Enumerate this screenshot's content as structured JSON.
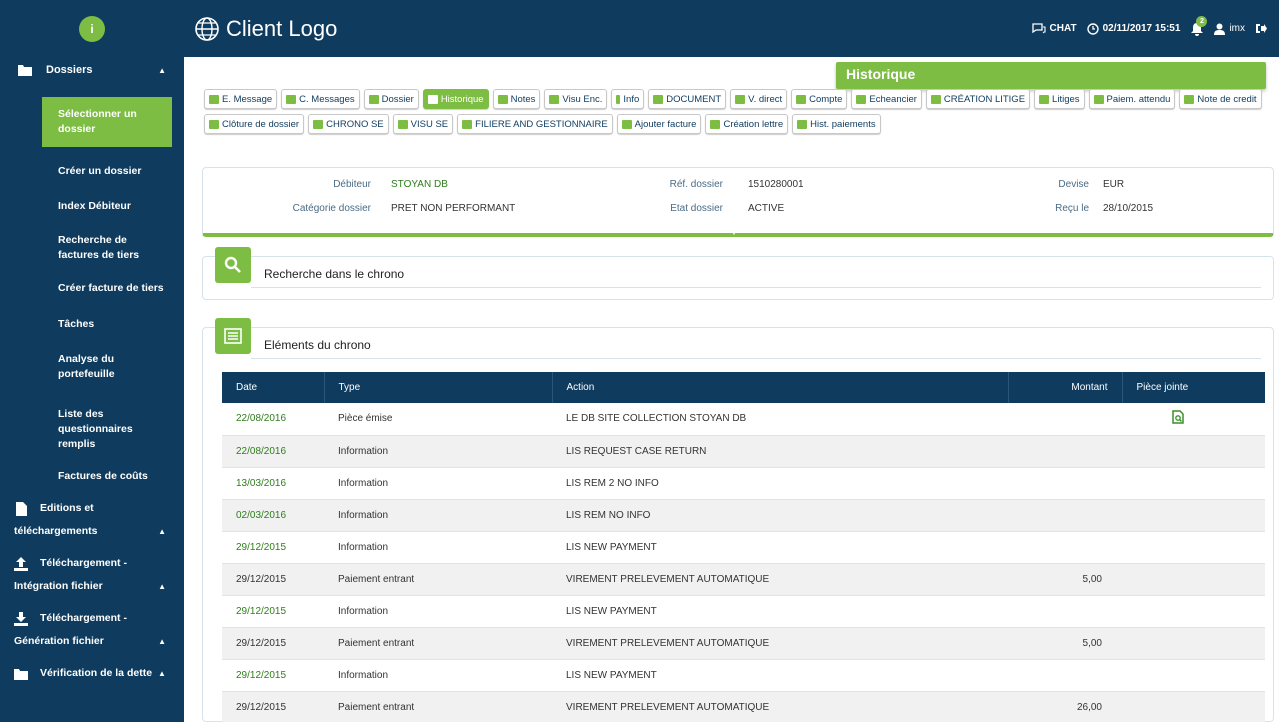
{
  "header": {
    "brand": "Client Logo",
    "chat": "CHAT",
    "datetime": "02/11/2017 15:51",
    "notifications": "2",
    "user": "imx"
  },
  "sidebar": {
    "logo_letter": "i",
    "groups": {
      "dossiers": "Dossiers",
      "editions_1": "Editions et",
      "editions_2": "téléchargements",
      "integration_1": "Téléchargement -",
      "integration_2": "Intégration fichier",
      "generation_1": "Téléchargement -",
      "generation_2": "Génération fichier",
      "verification": "Vérification de la dette"
    },
    "items": [
      {
        "label": "Sélectionner un dossier"
      },
      {
        "label": "Créer un dossier"
      },
      {
        "label": "Index Débiteur"
      },
      {
        "label": "Recherche de factures de tiers"
      },
      {
        "label": "Créer facture de tiers"
      },
      {
        "label": "Tâches"
      },
      {
        "label": "Analyse du portefeuille"
      },
      {
        "label": "Liste des questionnaires remplis"
      },
      {
        "label": "Factures de coûts"
      }
    ]
  },
  "page": {
    "banner": "Historique"
  },
  "toolbar": [
    {
      "label": "E. Message"
    },
    {
      "label": "C. Messages"
    },
    {
      "label": "Dossier"
    },
    {
      "label": "Historique"
    },
    {
      "label": "Notes"
    },
    {
      "label": "Visu Enc."
    },
    {
      "label": "Info"
    },
    {
      "label": "DOCUMENT"
    },
    {
      "label": "V. direct"
    },
    {
      "label": "Compte"
    },
    {
      "label": "Echeancier"
    },
    {
      "label": "CRÉATION LITIGE"
    },
    {
      "label": "Litiges"
    },
    {
      "label": "Paiem. attendu"
    },
    {
      "label": "Note de credit"
    },
    {
      "label": "Clôture de dossier"
    },
    {
      "label": "CHRONO SE"
    },
    {
      "label": "VISU SE"
    },
    {
      "label": "FILIERE AND GESTIONNAIRE"
    },
    {
      "label": "Ajouter facture"
    },
    {
      "label": "Création lettre"
    },
    {
      "label": "Hist. paiements"
    }
  ],
  "info": {
    "debiteur_label": "Débiteur",
    "debiteur": "STOYAN DB",
    "categorie_label": "Catégorie dossier",
    "categorie": "PRET NON PERFORMANT",
    "ref_label": "Réf. dossier",
    "ref": "1510280001",
    "etat_label": "Etat dossier",
    "etat": "ACTIVE",
    "devise_label": "Devise",
    "devise": "EUR",
    "recu_label": "Reçu le",
    "recu": "28/10/2015"
  },
  "search_section": {
    "title": "Recherche dans le chrono"
  },
  "chrono_section": {
    "title": "Eléments du chrono"
  },
  "table": {
    "headers": {
      "date": "Date",
      "type": "Type",
      "action": "Action",
      "montant": "Montant",
      "piece": "Pièce jointe"
    },
    "rows": [
      {
        "date": "22/08/2016",
        "type": "Pièce émise",
        "action": "LE DB SITE COLLECTION STOYAN DB",
        "montant": ""
      },
      {
        "date": "22/08/2016",
        "type": "Information",
        "action": "LIS REQUEST CASE RETURN",
        "montant": ""
      },
      {
        "date": "13/03/2016",
        "type": "Information",
        "action": "LIS REM 2 NO INFO",
        "montant": ""
      },
      {
        "date": "02/03/2016",
        "type": "Information",
        "action": "LIS REM NO INFO",
        "montant": ""
      },
      {
        "date": "29/12/2015",
        "type": "Information",
        "action": "LIS NEW PAYMENT",
        "montant": ""
      },
      {
        "date": "29/12/2015",
        "type": "Paiement entrant",
        "action": "VIREMENT PRELEVEMENT AUTOMATIQUE",
        "montant": "5,00"
      },
      {
        "date": "29/12/2015",
        "type": "Information",
        "action": "LIS NEW PAYMENT",
        "montant": ""
      },
      {
        "date": "29/12/2015",
        "type": "Paiement entrant",
        "action": "VIREMENT PRELEVEMENT AUTOMATIQUE",
        "montant": "5,00"
      },
      {
        "date": "29/12/2015",
        "type": "Information",
        "action": "LIS NEW PAYMENT",
        "montant": ""
      },
      {
        "date": "29/12/2015",
        "type": "Paiement entrant",
        "action": "VIREMENT PRELEVEMENT AUTOMATIQUE",
        "montant": "26,00"
      }
    ]
  },
  "colors": {
    "navy": "#0e3b5e",
    "green": "#7dbd44"
  }
}
